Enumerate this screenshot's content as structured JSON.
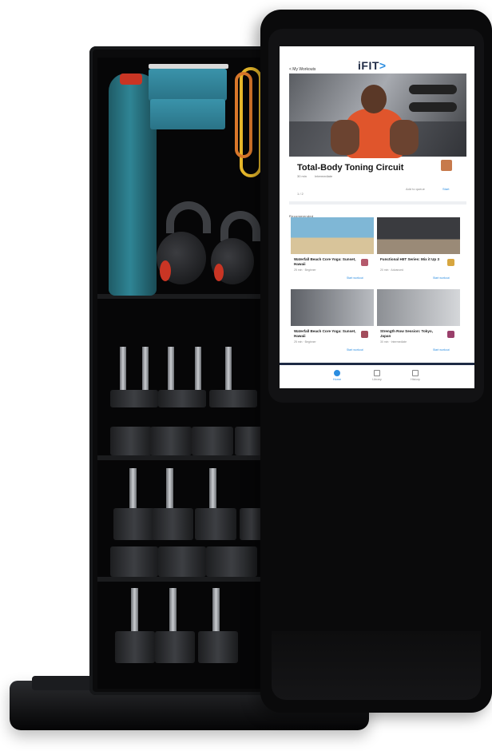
{
  "app": {
    "back_label": "< My Workouts",
    "logo_text": "iFIT",
    "logo_chevron": ">"
  },
  "featured": {
    "title": "Total-Body Toning Circuit",
    "meta_time": "30 min",
    "meta_level": "Intermediate",
    "action_left": "Add to queue",
    "action_right": "Start",
    "pager": "1 / 2"
  },
  "section": {
    "label": "Recommended"
  },
  "cards": [
    {
      "title": "Waterfall Beach Core Yoga: Sunset, Hawaii",
      "meta": "25 min · Beginner",
      "tag": "Yoga",
      "button": "Start workout",
      "colors": [
        "#7fb7d6",
        "#d8c49a"
      ]
    },
    {
      "title": "Functional HIIT Series: Mix it Up 3",
      "meta": "20 min · Advanced",
      "tag": "HIIT",
      "button": "Start workout",
      "colors": [
        "#3a3b3f",
        "#9a8a77"
      ]
    },
    {
      "title": "Waterfall Beach Core Yoga: Sunset, Hawaii",
      "meta": "25 min · Beginner",
      "tag": "Yoga",
      "button": "Start workout",
      "colors": [
        "#5d6066",
        "#b9bcc1"
      ]
    },
    {
      "title": "Strength Row Session: Tokyo, Japan",
      "meta": "30 min · Intermediate",
      "tag": "Strength",
      "button": "Start workout",
      "colors": [
        "#8c8f94",
        "#d5d7da"
      ]
    }
  ],
  "nav": [
    {
      "label": "Home",
      "active": true
    },
    {
      "label": "Library",
      "active": false
    },
    {
      "label": "History",
      "active": false
    }
  ],
  "colors": {
    "accent": "#2b8de0",
    "brand_navy": "#1e2a44",
    "bottle_teal": "#2f8595",
    "kettlebell_accent": "#c93524",
    "band_yellow": "#e7b82a"
  }
}
